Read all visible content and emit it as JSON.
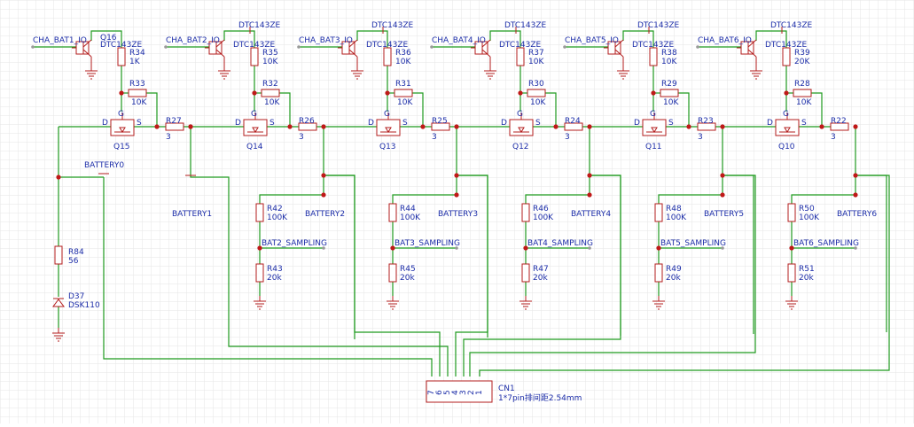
{
  "colors": {
    "wire": "#1f9a1f",
    "component": "#b31c1c",
    "label": "#1c2da8",
    "junction": "#c01818",
    "grid": "#e6e6e6"
  },
  "channels": [
    {
      "control_net": "CHA_BAT1_IO",
      "transistor_ref": "Q16",
      "transistor_part": "DTC143ZE",
      "pull_ref": "R34",
      "pull_val": "1K",
      "gate_ref": "R33",
      "gate_val": "10K",
      "mosfet_ref": "Q15",
      "series_ref": "R27",
      "series_val": "3",
      "battery_net": "BATTERY1",
      "div_top_ref": "",
      "div_top_val": "",
      "sampling_net": "",
      "div_bot_ref": "",
      "div_bot_val": ""
    },
    {
      "control_net": "CHA_BAT2_IO",
      "transistor_ref": "",
      "transistor_part": "DTC143ZE",
      "pull_ref": "R35",
      "pull_val": "10K",
      "gate_ref": "R32",
      "gate_val": "10K",
      "mosfet_ref": "Q14",
      "series_ref": "R26",
      "series_val": "3",
      "battery_net": "BATTERY2",
      "div_top_ref": "R42",
      "div_top_val": "100K",
      "sampling_net": "BAT2_SAMPLING",
      "div_bot_ref": "R43",
      "div_bot_val": "20k"
    },
    {
      "control_net": "CHA_BAT3_IO",
      "transistor_ref": "",
      "transistor_part": "DTC143ZE",
      "pull_ref": "R36",
      "pull_val": "10K",
      "gate_ref": "R31",
      "gate_val": "10K",
      "mosfet_ref": "Q13",
      "series_ref": "R25",
      "series_val": "3",
      "battery_net": "BATTERY3",
      "div_top_ref": "R44",
      "div_top_val": "100K",
      "sampling_net": "BAT3_SAMPLING",
      "div_bot_ref": "R45",
      "div_bot_val": "20k"
    },
    {
      "control_net": "CHA_BAT4_IO",
      "transistor_ref": "",
      "transistor_part": "DTC143ZE",
      "pull_ref": "R37",
      "pull_val": "10K",
      "gate_ref": "R30",
      "gate_val": "10K",
      "mosfet_ref": "Q12",
      "series_ref": "R24",
      "series_val": "3",
      "battery_net": "BATTERY4",
      "div_top_ref": "R46",
      "div_top_val": "100K",
      "sampling_net": "BAT4_SAMPLING",
      "div_bot_ref": "R47",
      "div_bot_val": "20k"
    },
    {
      "control_net": "CHA_BAT5_IO",
      "transistor_ref": "",
      "transistor_part": "DTC143ZE",
      "pull_ref": "R38",
      "pull_val": "10K",
      "gate_ref": "R29",
      "gate_val": "10K",
      "mosfet_ref": "Q11",
      "series_ref": "R23",
      "series_val": "3",
      "battery_net": "BATTERY5",
      "div_top_ref": "R48",
      "div_top_val": "100K",
      "sampling_net": "BAT5_SAMPLING",
      "div_bot_ref": "R49",
      "div_bot_val": "20k"
    },
    {
      "control_net": "CHA_BAT6_IO",
      "transistor_ref": "",
      "transistor_part": "DTC143ZE",
      "pull_ref": "R39",
      "pull_val": "20K",
      "gate_ref": "R28",
      "gate_val": "10K",
      "mosfet_ref": "Q10",
      "series_ref": "R22",
      "series_val": "3",
      "battery_net": "BATTERY6",
      "div_top_ref": "R50",
      "div_top_val": "100K",
      "sampling_net": "BAT6_SAMPLING",
      "div_bot_ref": "R51",
      "div_bot_val": "20k"
    }
  ],
  "left_branch": {
    "net": "BATTERY0",
    "resistor_ref": "R84",
    "resistor_val": "56",
    "diode_ref": "D37",
    "diode_part": "DSK110"
  },
  "connector": {
    "ref": "CN1",
    "desc": "1*7pin排间距2.54mm",
    "pins": [
      "7",
      "6",
      "5",
      "4",
      "3",
      "2",
      "1"
    ]
  }
}
